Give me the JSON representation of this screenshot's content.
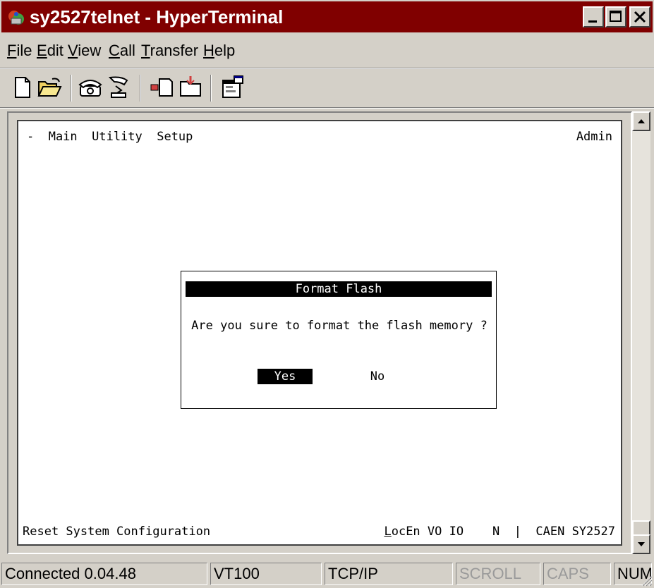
{
  "window": {
    "title": "sy2527telnet - HyperTerminal",
    "title_bar_color": "#800000"
  },
  "menu": {
    "items": [
      {
        "accel": "F",
        "rest": "ile"
      },
      {
        "accel": "E",
        "rest": "dit"
      },
      {
        "accel": "V",
        "rest": "iew"
      },
      {
        "accel": "C",
        "rest": "all"
      },
      {
        "accel": "T",
        "rest": "ransfer"
      },
      {
        "accel": "H",
        "rest": "elp"
      }
    ]
  },
  "toolbar": {
    "icons": [
      "new-icon",
      "open-icon",
      "connect-icon",
      "disconnect-icon",
      "send-icon",
      "receive-icon",
      "properties-icon"
    ]
  },
  "terminal": {
    "top_menu": "-  Main  Utility  Setup",
    "user": "Admin",
    "dialog": {
      "title": "Format Flash",
      "message": "Are you sure to format the flash memory ?",
      "yes": "Yes",
      "no": "No"
    },
    "bottom_left": "Reset System Configuration",
    "bottom_status_first": "L",
    "bottom_status_rest": "ocEn VO IO    N  |  CAEN SY2527"
  },
  "statusbar": {
    "connected": "Connected 0.04.48",
    "emulation": "VT100",
    "protocol": "TCP/IP",
    "scroll": "SCROLL",
    "caps": "CAPS",
    "num": "NUM"
  }
}
